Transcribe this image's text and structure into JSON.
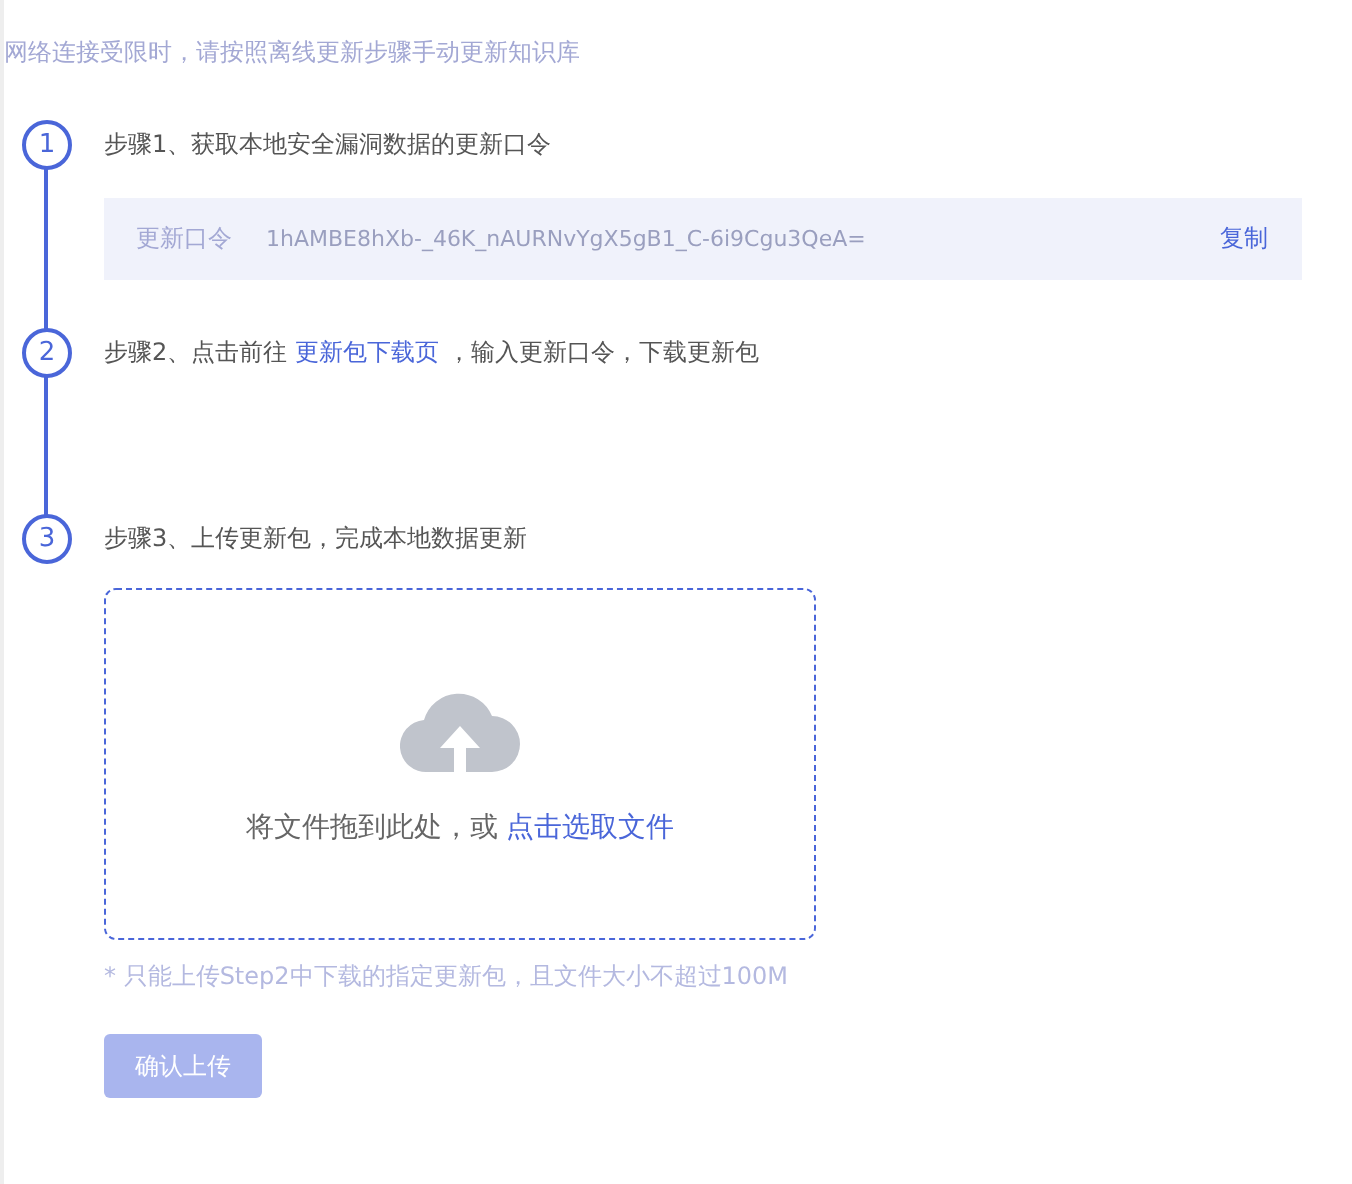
{
  "notice": "网络连接受限时，请按照离线更新步骤手动更新知识库",
  "steps": [
    {
      "number": "1",
      "text": "步骤1、获取本地安全漏洞数据的更新口令"
    },
    {
      "number": "2",
      "text": "步骤2、点击前往",
      "link": "更新包下载页",
      "after": "，输入更新口令，下载更新包"
    },
    {
      "number": "3",
      "text": "步骤3、上传更新包，完成本地数据更新"
    }
  ],
  "token": {
    "label": "更新口令",
    "value": "1hAMBE8hXb-_46K_nAURNvYgX5gB1_C-6i9Cgu3QeA=",
    "copy": "复制"
  },
  "upload": {
    "text": "将文件拖到此处，或",
    "link": "点击选取文件"
  },
  "note": "* 只能上传Step2中下载的指定更新包，且文件大小不超过100M",
  "confirm": {
    "label": "确认上传",
    "disabled": true
  }
}
